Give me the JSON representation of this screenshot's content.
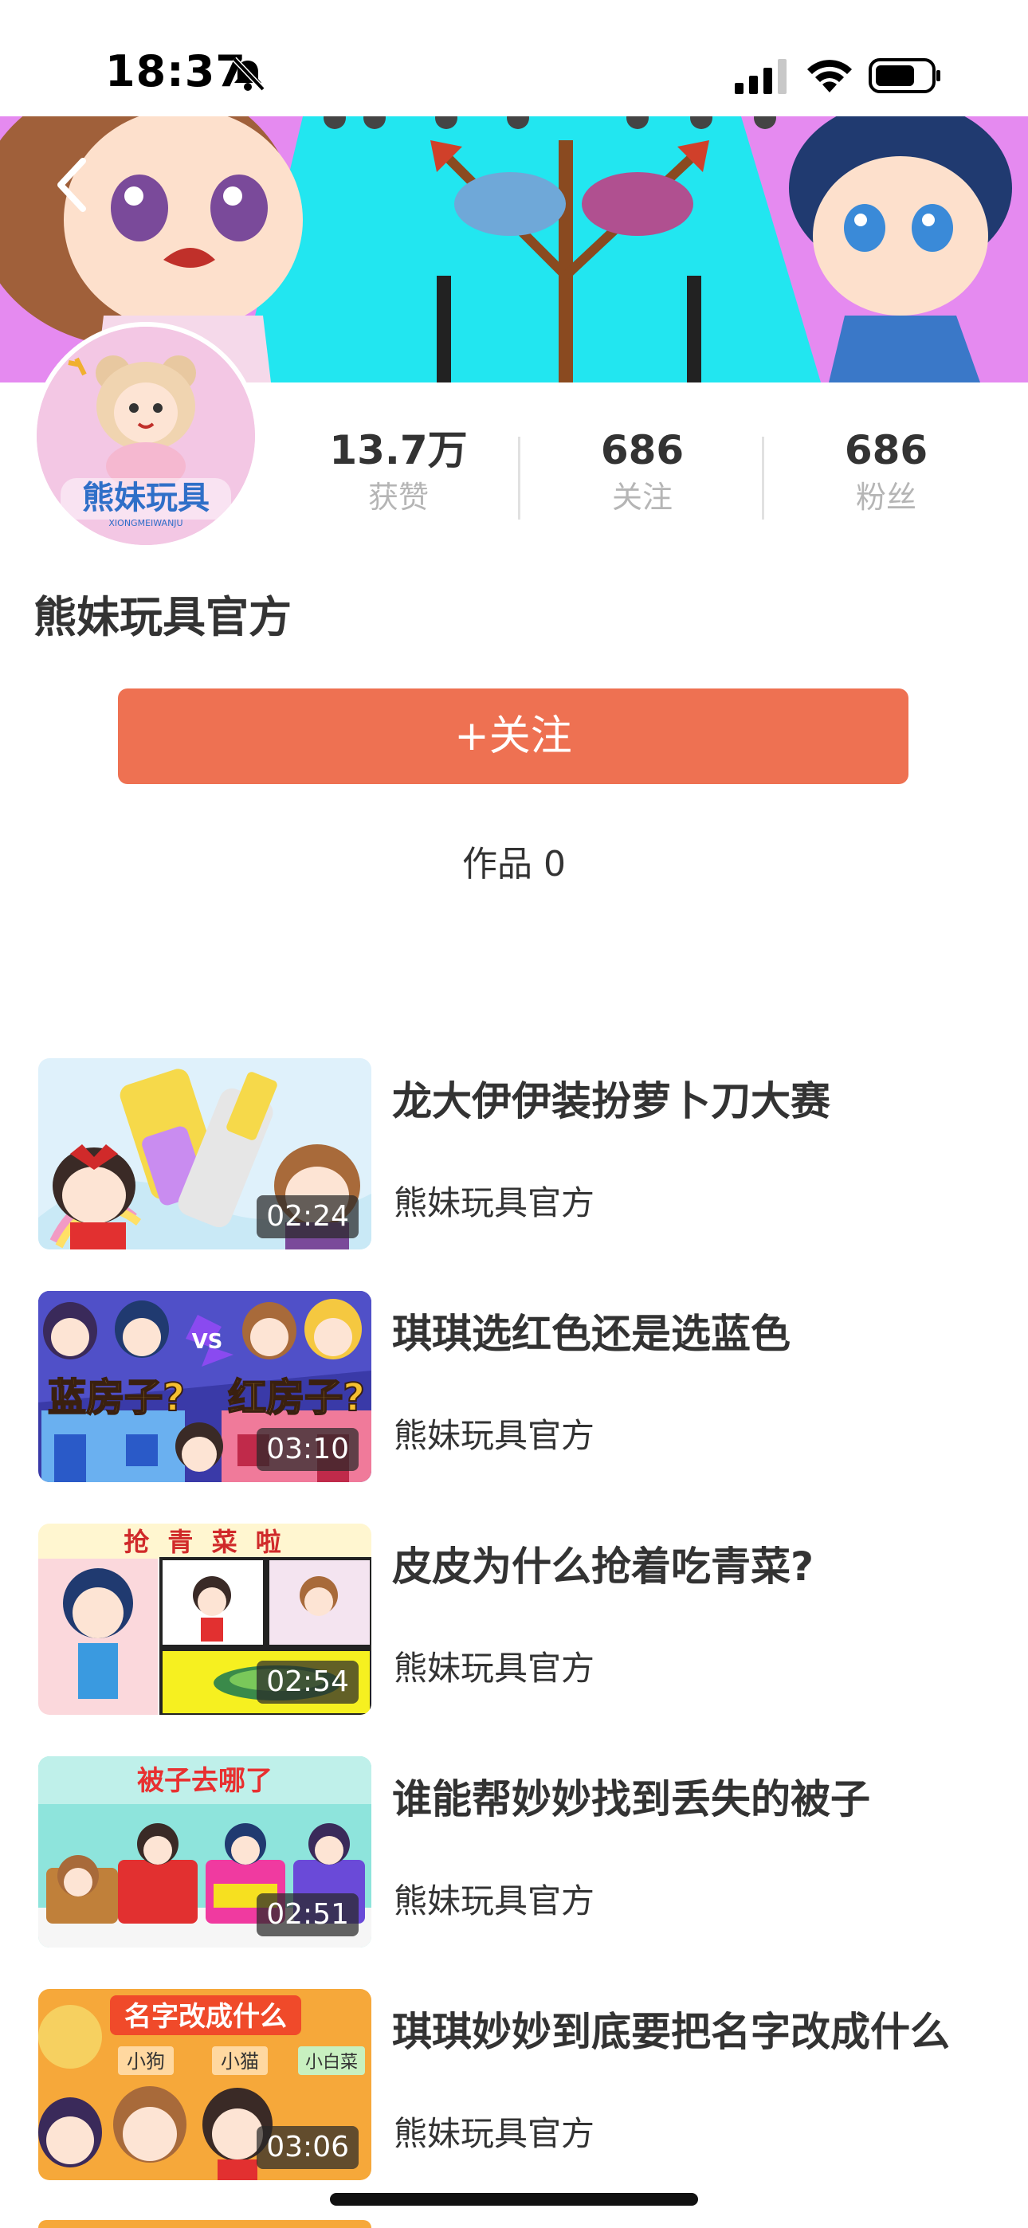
{
  "status_bar": {
    "time": "18:37",
    "icons": [
      "bell-muted-icon",
      "signal-icon",
      "wifi-icon",
      "battery-icon"
    ]
  },
  "navigation": {
    "back_icon": "chevron-left-icon"
  },
  "profile": {
    "name": "熊妹玩具官方",
    "avatar_logo_text": "熊妹玩具 XIONGMEIWANJU",
    "stats": [
      {
        "value": "13.7万",
        "label": "获赞"
      },
      {
        "value": "686",
        "label": "关注"
      },
      {
        "value": "686",
        "label": "粉丝"
      }
    ],
    "follow_button": "+关注",
    "works_label": "作品 0"
  },
  "videos": [
    {
      "title": "龙大伊伊装扮萝卜刀大赛",
      "author": "熊妹玩具官方",
      "duration": "02:24"
    },
    {
      "title": "琪琪选红色还是选蓝色",
      "author": "熊妹玩具官方",
      "duration": "03:10"
    },
    {
      "title": "皮皮为什么抢着吃青菜?",
      "author": "熊妹玩具官方",
      "duration": "02:54"
    },
    {
      "title": "谁能帮妙妙找到丢失的被子",
      "author": "熊妹玩具官方",
      "duration": "02:51"
    },
    {
      "title": "琪琪妙妙到底要把名字改成什么",
      "author": "熊妹玩具官方",
      "duration": "03:06"
    }
  ],
  "thumbnail_captions": {
    "v2_left": "蓝房子?",
    "v2_right": "红房子?",
    "v2_vs": "VS",
    "v3_banner": "抢 青 菜 啦",
    "v4_banner": "被子去哪了",
    "v5_banner": "名字改成什么",
    "v5_tags": [
      "小狗",
      "小猫",
      "小白菜"
    ]
  },
  "colors": {
    "accent": "#ee7152",
    "muted_text": "#b5b5b5",
    "text": "#333333"
  }
}
